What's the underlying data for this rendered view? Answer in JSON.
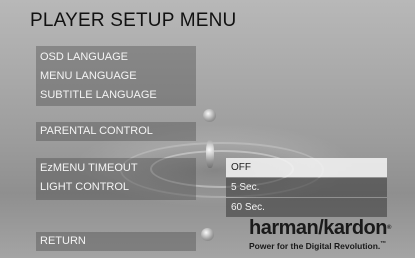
{
  "header": {
    "title": "PLAYER SETUP MENU"
  },
  "menu": {
    "items": [
      {
        "label": "OSD LANGUAGE"
      },
      {
        "label": "MENU LANGUAGE"
      },
      {
        "label": "SUBTITLE LANGUAGE"
      },
      {
        "label": "PARENTAL CONTROL"
      },
      {
        "label": "EzMENU TIMEOUT"
      },
      {
        "label": "LIGHT CONTROL"
      },
      {
        "label": "RETURN"
      }
    ]
  },
  "submenu": {
    "options": [
      {
        "label": "OFF",
        "selected": true
      },
      {
        "label": "5 Sec."
      },
      {
        "label": "60 Sec."
      }
    ]
  },
  "brand": {
    "name": "harman/kardon",
    "registered_mark": "®",
    "tagline": "Power for the Digital Revolution.",
    "tagline_mark": "™"
  },
  "colors": {
    "selected_option_bg": "#f5f5f5",
    "menu_text": "#f4f4f4",
    "title_text": "#111111"
  }
}
